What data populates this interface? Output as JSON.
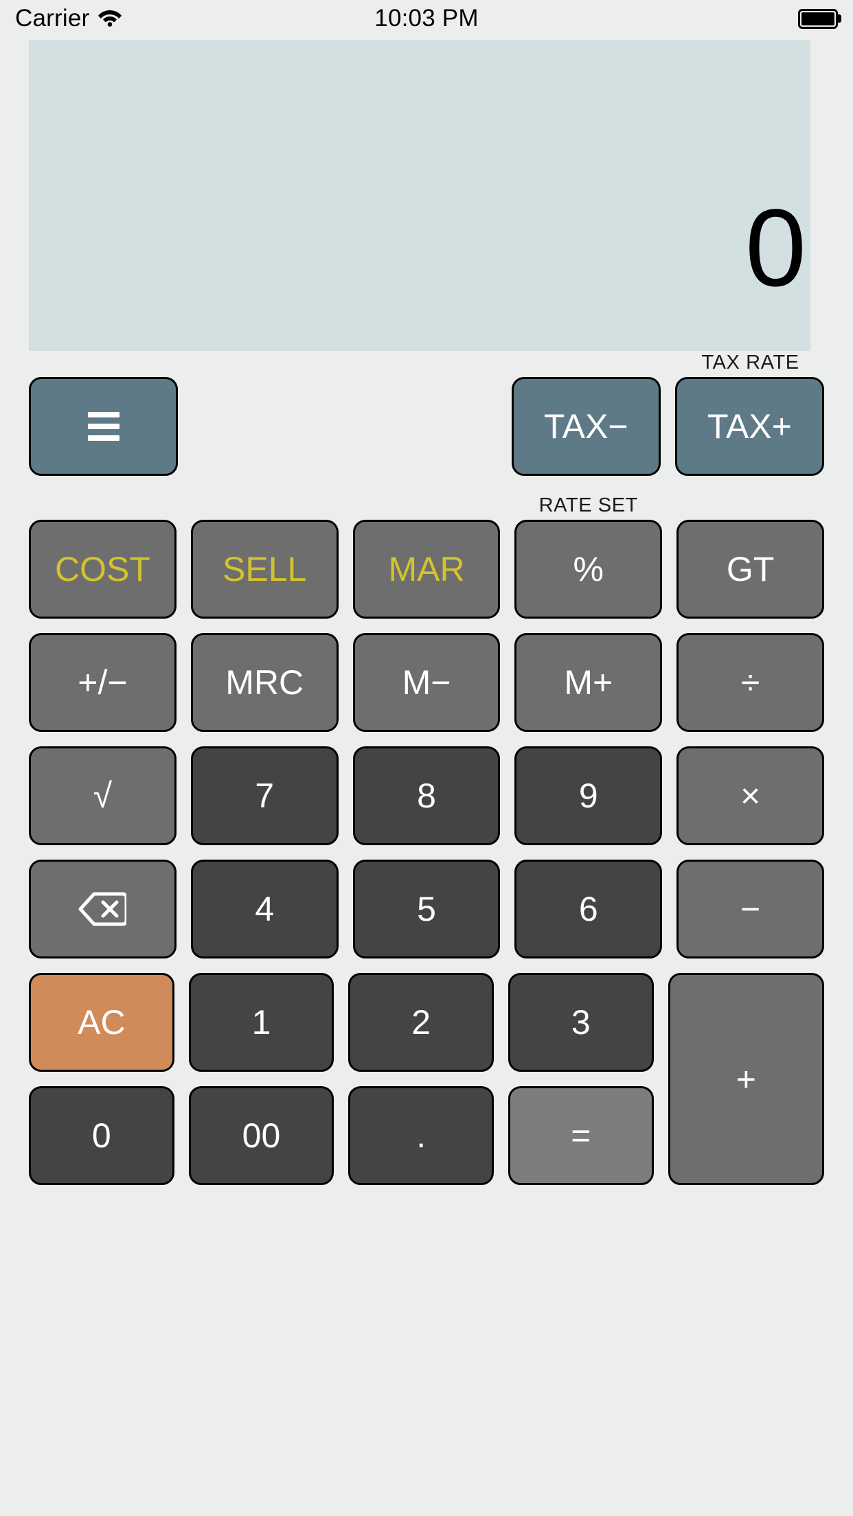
{
  "status_bar": {
    "carrier": "Carrier",
    "wifi_icon": "wifi-icon",
    "time": "10:03 PM",
    "battery_icon": "battery-icon"
  },
  "display": {
    "value": "0"
  },
  "labels": {
    "tax_rate": "TAX RATE",
    "rate_set": "RATE SET"
  },
  "keys": {
    "menu": "≡",
    "tax_minus": "TAX−",
    "tax_plus": "TAX+",
    "cost": "COST",
    "sell": "SELL",
    "mar": "MAR",
    "percent": "%",
    "gt": "GT",
    "plusminus": "+/−",
    "mrc": "MRC",
    "m_minus": "M−",
    "m_plus": "M+",
    "divide": "÷",
    "sqrt": "√",
    "seven": "7",
    "eight": "8",
    "nine": "9",
    "multiply": "×",
    "backspace": "backspace-icon",
    "four": "4",
    "five": "5",
    "six": "6",
    "minus": "−",
    "ac": "AC",
    "one": "1",
    "two": "2",
    "three": "3",
    "plus": "+",
    "zero": "0",
    "double_zero": "00",
    "decimal": ".",
    "equals": "="
  },
  "colors": {
    "background": "#eceded",
    "display_bg": "#d3e0e1",
    "tax_key": "#5f7a87",
    "func_key": "#6e6e6e",
    "num_key": "#444444",
    "ac_key": "#d18a5a",
    "equals_key": "#7d7d7d",
    "gold_text": "#d4c32c",
    "key_text": "#ffffff"
  }
}
